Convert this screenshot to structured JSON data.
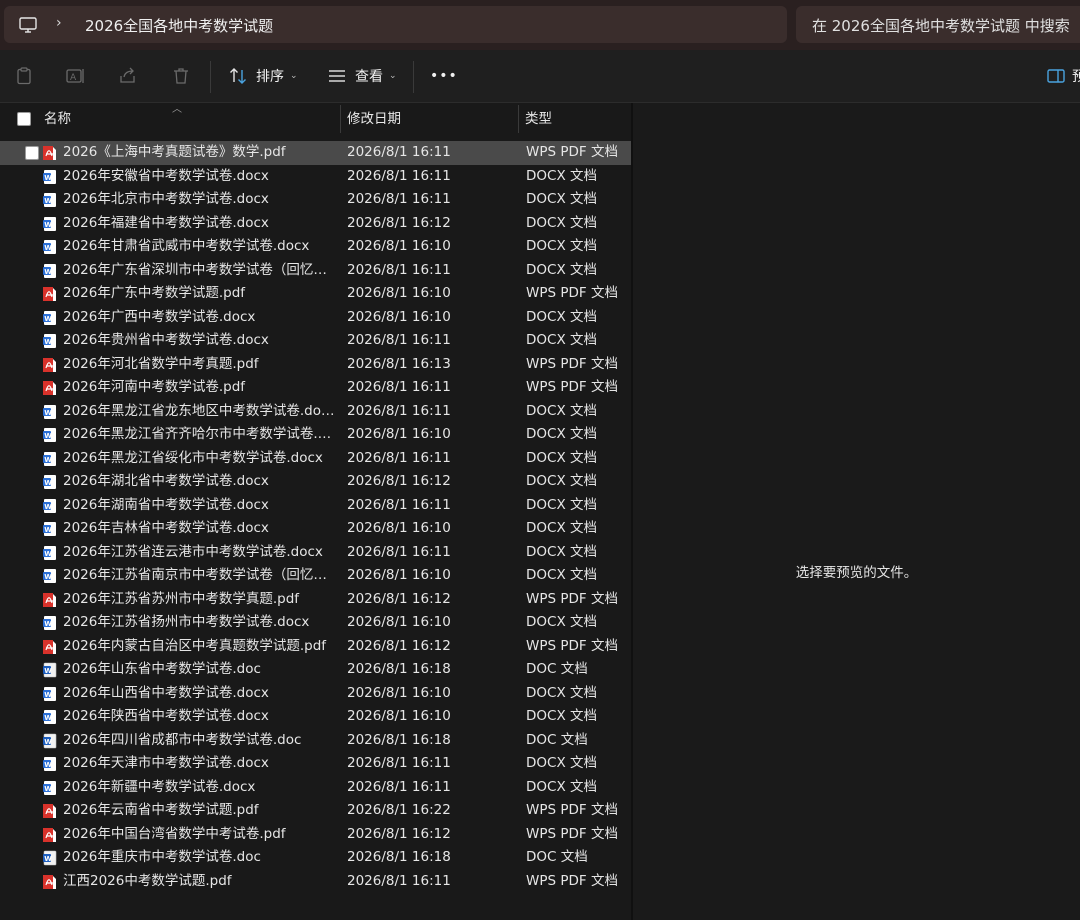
{
  "address_bar": {
    "icon": "this-pc-icon",
    "separator": "›",
    "path": "2026全国各地中考数学试题"
  },
  "search": {
    "placeholder": "在 2026全国各地中考数学试题 中搜索"
  },
  "toolbar": {
    "sort_label": "排序",
    "view_label": "查看",
    "more_label": "•••",
    "preview_label": "预"
  },
  "columns": {
    "name": "名称",
    "modified": "修改日期",
    "type": "类型"
  },
  "files": [
    {
      "name": "2026《上海中考真题试卷》数学.pdf",
      "date": "2026/8/1 16:11",
      "type": "WPS PDF 文档",
      "icon": "pdf"
    },
    {
      "name": "2026年安徽省中考数学试卷.docx",
      "date": "2026/8/1 16:11",
      "type": "DOCX 文档",
      "icon": "docx"
    },
    {
      "name": "2026年北京市中考数学试卷.docx",
      "date": "2026/8/1 16:11",
      "type": "DOCX 文档",
      "icon": "docx"
    },
    {
      "name": "2026年福建省中考数学试卷.docx",
      "date": "2026/8/1 16:12",
      "type": "DOCX 文档",
      "icon": "docx"
    },
    {
      "name": "2026年甘肃省武威市中考数学试卷.docx",
      "date": "2026/8/1 16:10",
      "type": "DOCX 文档",
      "icon": "docx"
    },
    {
      "name": "2026年广东省深圳市中考数学试卷（回忆版...",
      "date": "2026/8/1 16:11",
      "type": "DOCX 文档",
      "icon": "docx"
    },
    {
      "name": "2026年广东中考数学试题.pdf",
      "date": "2026/8/1 16:10",
      "type": "WPS PDF 文档",
      "icon": "pdf"
    },
    {
      "name": "2026年广西中考数学试卷.docx",
      "date": "2026/8/1 16:10",
      "type": "DOCX 文档",
      "icon": "docx"
    },
    {
      "name": "2026年贵州省中考数学试卷.docx",
      "date": "2026/8/1 16:11",
      "type": "DOCX 文档",
      "icon": "docx"
    },
    {
      "name": "2026年河北省数学中考真题.pdf",
      "date": "2026/8/1 16:13",
      "type": "WPS PDF 文档",
      "icon": "pdf"
    },
    {
      "name": "2026年河南中考数学试卷.pdf",
      "date": "2026/8/1 16:11",
      "type": "WPS PDF 文档",
      "icon": "pdf"
    },
    {
      "name": "2026年黑龙江省龙东地区中考数学试卷.docx",
      "date": "2026/8/1 16:11",
      "type": "DOCX 文档",
      "icon": "docx"
    },
    {
      "name": "2026年黑龙江省齐齐哈尔市中考数学试卷.d...",
      "date": "2026/8/1 16:10",
      "type": "DOCX 文档",
      "icon": "docx"
    },
    {
      "name": "2026年黑龙江省绥化市中考数学试卷.docx",
      "date": "2026/8/1 16:11",
      "type": "DOCX 文档",
      "icon": "docx"
    },
    {
      "name": "2026年湖北省中考数学试卷.docx",
      "date": "2026/8/1 16:12",
      "type": "DOCX 文档",
      "icon": "docx"
    },
    {
      "name": "2026年湖南省中考数学试卷.docx",
      "date": "2026/8/1 16:11",
      "type": "DOCX 文档",
      "icon": "docx"
    },
    {
      "name": "2026年吉林省中考数学试卷.docx",
      "date": "2026/8/1 16:10",
      "type": "DOCX 文档",
      "icon": "docx"
    },
    {
      "name": "2026年江苏省连云港市中考数学试卷.docx",
      "date": "2026/8/1 16:11",
      "type": "DOCX 文档",
      "icon": "docx"
    },
    {
      "name": "2026年江苏省南京市中考数学试卷（回忆版...",
      "date": "2026/8/1 16:10",
      "type": "DOCX 文档",
      "icon": "docx"
    },
    {
      "name": "2026年江苏省苏州市中考数学真题.pdf",
      "date": "2026/8/1 16:12",
      "type": "WPS PDF 文档",
      "icon": "pdf"
    },
    {
      "name": "2026年江苏省扬州市中考数学试卷.docx",
      "date": "2026/8/1 16:10",
      "type": "DOCX 文档",
      "icon": "docx"
    },
    {
      "name": "2026年内蒙古自治区中考真题数学试题.pdf",
      "date": "2026/8/1 16:12",
      "type": "WPS PDF 文档",
      "icon": "pdf"
    },
    {
      "name": "2026年山东省中考数学试卷.doc",
      "date": "2026/8/1 16:18",
      "type": "DOC 文档",
      "icon": "doc"
    },
    {
      "name": "2026年山西省中考数学试卷.docx",
      "date": "2026/8/1 16:10",
      "type": "DOCX 文档",
      "icon": "docx"
    },
    {
      "name": "2026年陕西省中考数学试卷.docx",
      "date": "2026/8/1 16:10",
      "type": "DOCX 文档",
      "icon": "docx"
    },
    {
      "name": "2026年四川省成都市中考数学试卷.doc",
      "date": "2026/8/1 16:18",
      "type": "DOC 文档",
      "icon": "doc"
    },
    {
      "name": "2026年天津市中考数学试卷.docx",
      "date": "2026/8/1 16:11",
      "type": "DOCX 文档",
      "icon": "docx"
    },
    {
      "name": "2026年新疆中考数学试卷.docx",
      "date": "2026/8/1 16:11",
      "type": "DOCX 文档",
      "icon": "docx"
    },
    {
      "name": "2026年云南省中考数学试题.pdf",
      "date": "2026/8/1 16:22",
      "type": "WPS PDF 文档",
      "icon": "pdf"
    },
    {
      "name": "2026年中国台湾省数学中考试卷.pdf",
      "date": "2026/8/1 16:12",
      "type": "WPS PDF 文档",
      "icon": "pdf"
    },
    {
      "name": "2026年重庆市中考数学试卷.doc",
      "date": "2026/8/1 16:18",
      "type": "DOC 文档",
      "icon": "doc"
    },
    {
      "name": "江西2026中考数学试题.pdf",
      "date": "2026/8/1 16:11",
      "type": "WPS PDF 文档",
      "icon": "pdf"
    }
  ],
  "preview": {
    "message": "选择要预览的文件。"
  },
  "colors": {
    "accent": "#4aa3df",
    "pdf_red": "#d9322b",
    "word_blue": "#2b6fd6"
  }
}
